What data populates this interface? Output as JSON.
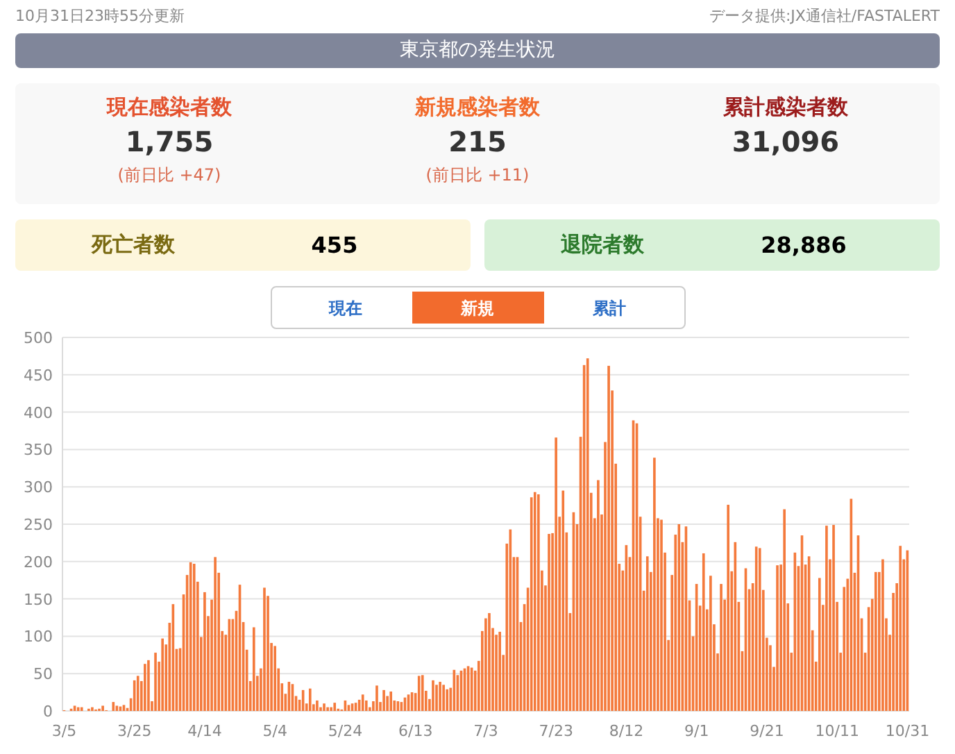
{
  "header": {
    "updated": "10月31日23時55分更新",
    "source": "データ提供:JX通信社/FASTALERT"
  },
  "title": "東京都の発生状況",
  "stats": [
    {
      "label": "現在感染者数",
      "value": "1,755",
      "change": "(前日比 +47)",
      "color": "#e4532f"
    },
    {
      "label": "新規感染者数",
      "value": "215",
      "change": "(前日比 +11)",
      "color": "#f26b2d"
    },
    {
      "label": "累計感染者数",
      "value": "31,096",
      "color": "#9c1c1c"
    }
  ],
  "outcomes": [
    {
      "label": "死亡者数",
      "value": "455",
      "kind": "death"
    },
    {
      "label": "退院者数",
      "value": "28,886",
      "kind": "recovered"
    }
  ],
  "toggle": [
    {
      "label": "現在",
      "selected": false
    },
    {
      "label": "新規",
      "selected": true
    },
    {
      "label": "累計",
      "selected": false
    }
  ],
  "chart_data": {
    "type": "bar",
    "ylim": [
      0,
      500
    ],
    "yticks": [
      0,
      50,
      100,
      150,
      200,
      250,
      300,
      350,
      400,
      450,
      500
    ],
    "grid": true,
    "categories": [
      "3/5",
      null,
      null,
      null,
      null,
      null,
      null,
      null,
      null,
      null,
      null,
      null,
      null,
      null,
      null,
      null,
      null,
      null,
      null,
      null,
      "3/25",
      null,
      null,
      null,
      null,
      null,
      null,
      null,
      null,
      null,
      null,
      null,
      null,
      null,
      null,
      null,
      null,
      null,
      null,
      null,
      "4/14",
      null,
      null,
      null,
      null,
      null,
      null,
      null,
      null,
      null,
      null,
      null,
      null,
      null,
      null,
      null,
      null,
      null,
      null,
      null,
      "5/4",
      null,
      null,
      null,
      null,
      null,
      null,
      null,
      null,
      null,
      null,
      null,
      null,
      null,
      null,
      null,
      null,
      null,
      null,
      null,
      "5/24",
      null,
      null,
      null,
      null,
      null,
      null,
      null,
      null,
      null,
      null,
      null,
      null,
      null,
      null,
      null,
      null,
      null,
      null,
      null,
      "6/13",
      null,
      null,
      null,
      null,
      null,
      null,
      null,
      null,
      null,
      null,
      null,
      null,
      null,
      null,
      null,
      null,
      null,
      null,
      null,
      "7/3",
      null,
      null,
      null,
      null,
      null,
      null,
      null,
      null,
      null,
      null,
      null,
      null,
      null,
      null,
      null,
      null,
      null,
      null,
      null,
      "7/23",
      null,
      null,
      null,
      null,
      null,
      null,
      null,
      null,
      null,
      null,
      null,
      null,
      null,
      null,
      null,
      null,
      null,
      null,
      null,
      "8/12",
      null,
      null,
      null,
      null,
      null,
      null,
      null,
      null,
      null,
      null,
      null,
      null,
      null,
      null,
      null,
      null,
      null,
      null,
      null,
      "9/1",
      null,
      null,
      null,
      null,
      null,
      null,
      null,
      null,
      null,
      null,
      null,
      null,
      null,
      null,
      null,
      null,
      null,
      null,
      null,
      "9/21",
      null,
      null,
      null,
      null,
      null,
      null,
      null,
      null,
      null,
      null,
      null,
      null,
      null,
      null,
      null,
      null,
      null,
      null,
      null,
      "10/11",
      null,
      null,
      null,
      null,
      null,
      null,
      null,
      null,
      null,
      null,
      null,
      null,
      null,
      null,
      null,
      null,
      null,
      null,
      null,
      "10/31"
    ],
    "series": [
      {
        "color": "#f47a3c",
        "values": [
          1,
          0,
          3,
          7,
          5,
          5,
          0,
          3,
          5,
          2,
          3,
          7,
          1,
          0,
          12,
          7,
          6,
          8,
          4,
          17,
          41,
          47,
          40,
          63,
          68,
          13,
          78,
          66,
          97,
          89,
          118,
          143,
          83,
          84,
          156,
          182,
          199,
          197,
          173,
          99,
          159,
          127,
          149,
          206,
          185,
          107,
          102,
          123,
          123,
          134,
          169,
          119,
          82,
          40,
          112,
          47,
          57,
          165,
          154,
          91,
          87,
          57,
          37,
          23,
          39,
          36,
          20,
          15,
          28,
          10,
          30,
          9,
          14,
          5,
          10,
          5,
          5,
          11,
          3,
          2,
          14,
          8,
          10,
          11,
          15,
          22,
          14,
          5,
          13,
          34,
          12,
          28,
          20,
          26,
          14,
          13,
          12,
          18,
          22,
          25,
          24,
          47,
          48,
          27,
          16,
          41,
          35,
          39,
          35,
          29,
          31,
          55,
          48,
          54,
          57,
          60,
          58,
          54,
          67,
          107,
          124,
          131,
          111,
          102,
          106,
          75,
          224,
          243,
          206,
          206,
          119,
          143,
          165,
          286,
          293,
          290,
          188,
          168,
          237,
          238,
          366,
          260,
          295,
          239,
          131,
          266,
          250,
          367,
          463,
          472,
          292,
          258,
          309,
          263,
          360,
          462,
          429,
          331,
          197,
          188,
          222,
          206,
          389,
          385,
          260,
          161,
          207,
          186,
          339,
          258,
          256,
          212,
          95,
          182,
          236,
          250,
          226,
          247,
          148,
          100,
          170,
          141,
          211,
          136,
          181,
          116,
          77,
          170,
          149,
          276,
          187,
          226,
          146,
          80,
          191,
          163,
          171,
          220,
          218,
          162,
          98,
          88,
          59,
          195,
          196,
          270,
          144,
          78,
          212,
          194,
          235,
          196,
          207,
          108,
          66,
          178,
          142,
          248,
          203,
          249,
          146,
          78,
          166,
          177,
          284,
          185,
          235,
          124,
          78,
          139,
          150,
          186,
          186,
          203,
          124,
          102,
          158,
          171,
          221,
          203,
          215
        ]
      }
    ]
  }
}
